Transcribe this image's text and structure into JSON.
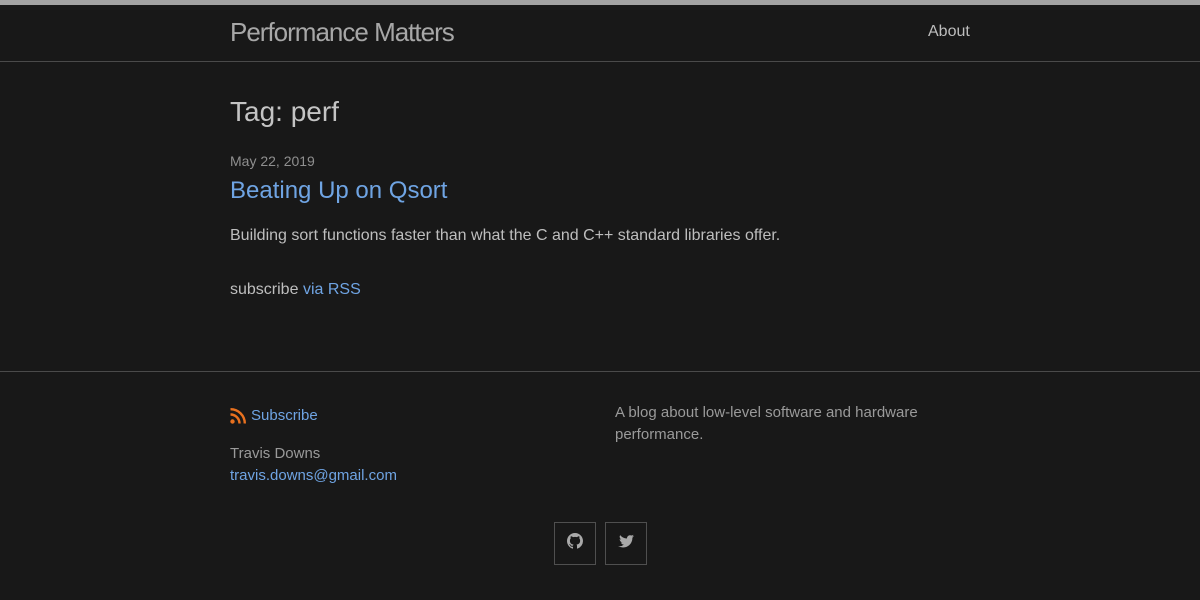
{
  "header": {
    "site_title": "Performance Matters",
    "nav": [
      {
        "label": "About"
      }
    ]
  },
  "main": {
    "page_heading": "Tag: perf",
    "posts": [
      {
        "date": "May 22, 2019",
        "title": "Beating Up on Qsort",
        "excerpt": "Building sort functions faster than what the C and C++ standard libraries offer."
      }
    ],
    "rss": {
      "prefix": "subscribe",
      "link_label": "via RSS"
    }
  },
  "footer": {
    "subscribe_label": "Subscribe",
    "author_name": "Travis Downs",
    "author_email": "travis.downs@gmail.com",
    "description": "A blog about low-level software and hardware performance.",
    "social_icons": [
      "github-icon",
      "twitter-icon"
    ]
  },
  "colors": {
    "background": "#181818",
    "link": "#6fa4e3",
    "rss_orange": "#e8711f",
    "top_bar": "#a3a3a3",
    "divider": "#4a4a4a"
  }
}
